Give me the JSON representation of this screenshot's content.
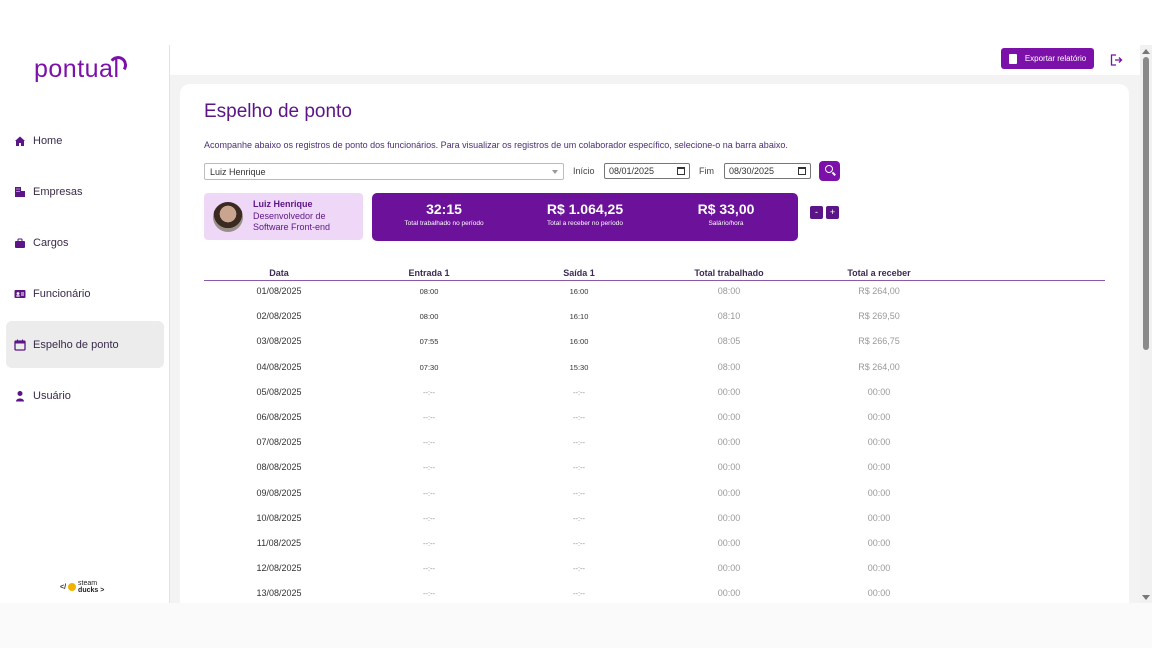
{
  "app": {
    "logo_text": "pontual",
    "brand_color": "#7b11a8",
    "footer_brand_left": "</",
    "footer_brand_line1": "steam",
    "footer_brand_line2": "ducks >"
  },
  "sidebar": {
    "items": [
      {
        "label": "Home",
        "icon": "home-icon",
        "active": false
      },
      {
        "label": "Empresas",
        "icon": "building-icon",
        "active": false
      },
      {
        "label": "Cargos",
        "icon": "briefcase-icon",
        "active": false
      },
      {
        "label": "Funcionário",
        "icon": "id-card-icon",
        "active": false
      },
      {
        "label": "Espelho de ponto",
        "icon": "calendar-icon",
        "active": true
      },
      {
        "label": "Usuário",
        "icon": "user-icon",
        "active": false
      }
    ]
  },
  "topbar": {
    "export_label": "Exportar relatório",
    "logout_icon": "logout-icon"
  },
  "page": {
    "title": "Espelho de ponto",
    "subtitle": "Acompanhe abaixo os registros de ponto dos funcionários. Para visualizar os registros de um colaborador específico, selecione-o na barra abaixo."
  },
  "filters": {
    "employee_selected": "Luiz Henrique",
    "start_label": "Início",
    "start_value": "08/01/2025",
    "end_label": "Fim",
    "end_value": "08/30/2025"
  },
  "employee": {
    "name": "Luiz Henrique",
    "role": "Desenvolvedor de Software Front-end"
  },
  "stats": {
    "worked_value": "32:15",
    "worked_caption": "Total trabalhado no período",
    "receive_value": "R$ 1.064,25",
    "receive_caption": "Total a receber no período",
    "hourly_value": "R$ 33,00",
    "hourly_caption": "Salário/hora"
  },
  "zoom": {
    "minus": "-",
    "plus": "+"
  },
  "table": {
    "headers": [
      "Data",
      "Entrada 1",
      "Saída 1",
      "Total trabalhado",
      "Total a receber"
    ],
    "rows": [
      [
        "01/08/2025",
        "08:00",
        "16:00",
        "08:00",
        "R$ 264,00"
      ],
      [
        "02/08/2025",
        "08:00",
        "16:10",
        "08:10",
        "R$ 269,50"
      ],
      [
        "03/08/2025",
        "07:55",
        "16:00",
        "08:05",
        "R$ 266,75"
      ],
      [
        "04/08/2025",
        "07:30",
        "15:30",
        "08:00",
        "R$ 264,00"
      ],
      [
        "05/08/2025",
        "--:--",
        "--:--",
        "00:00",
        "00:00"
      ],
      [
        "06/08/2025",
        "--:--",
        "--:--",
        "00:00",
        "00:00"
      ],
      [
        "07/08/2025",
        "--:--",
        "--:--",
        "00:00",
        "00:00"
      ],
      [
        "08/08/2025",
        "--:--",
        "--:--",
        "00:00",
        "00:00"
      ],
      [
        "09/08/2025",
        "--:--",
        "--:--",
        "00:00",
        "00:00"
      ],
      [
        "10/08/2025",
        "--:--",
        "--:--",
        "00:00",
        "00:00"
      ],
      [
        "11/08/2025",
        "--:--",
        "--:--",
        "00:00",
        "00:00"
      ],
      [
        "12/08/2025",
        "--:--",
        "--:--",
        "00:00",
        "00:00"
      ],
      [
        "13/08/2025",
        "--:--",
        "--:--",
        "00:00",
        "00:00"
      ]
    ]
  }
}
